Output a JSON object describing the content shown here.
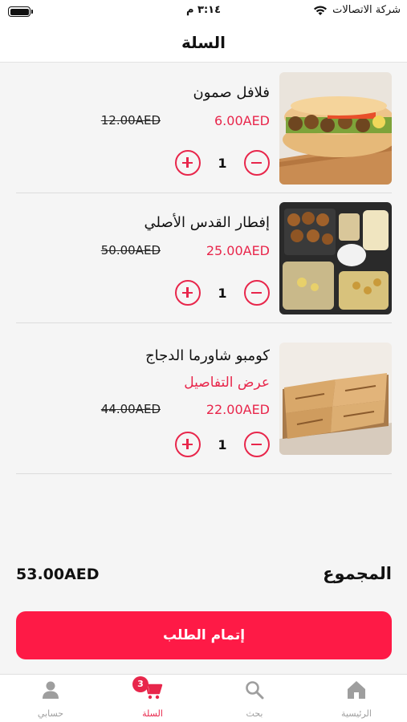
{
  "status_bar": {
    "carrier": "شركة الاتصالات",
    "time": "٣:١٤ م",
    "battery_level": 1.0
  },
  "header": {
    "title": "السلة"
  },
  "cart": {
    "items": [
      {
        "name": "فلافل صمون",
        "details_link": "",
        "price": "6.00AED",
        "original_price": "12.00AED",
        "quantity": "1",
        "image": "falafel-sandwich-photo"
      },
      {
        "name": "إفطار القدس الأصلي",
        "details_link": "",
        "price": "25.00AED",
        "original_price": "50.00AED",
        "quantity": "1",
        "image": "breakfast-box-photo"
      },
      {
        "name": "كومبو شاورما الدجاج",
        "details_link": "عرض التفاصيل",
        "price": "22.00AED",
        "original_price": "44.00AED",
        "quantity": "1",
        "image": "shawarma-photo"
      }
    ],
    "total_label": "المجموع",
    "total_value": "53.00AED",
    "checkout_label": "إتمام الطلب"
  },
  "bottom_nav": {
    "items": [
      {
        "label": "الرئيسية",
        "icon": "home-icon"
      },
      {
        "label": "بحث",
        "icon": "search-icon"
      },
      {
        "label": "السلة",
        "icon": "cart-icon",
        "badge": "3",
        "active": true
      },
      {
        "label": "حسابي",
        "icon": "user-icon"
      }
    ]
  },
  "colors": {
    "accent": "#e8264b",
    "button": "#fe1a46",
    "background": "#f5f5f5",
    "inactive": "#9e9e9e"
  }
}
